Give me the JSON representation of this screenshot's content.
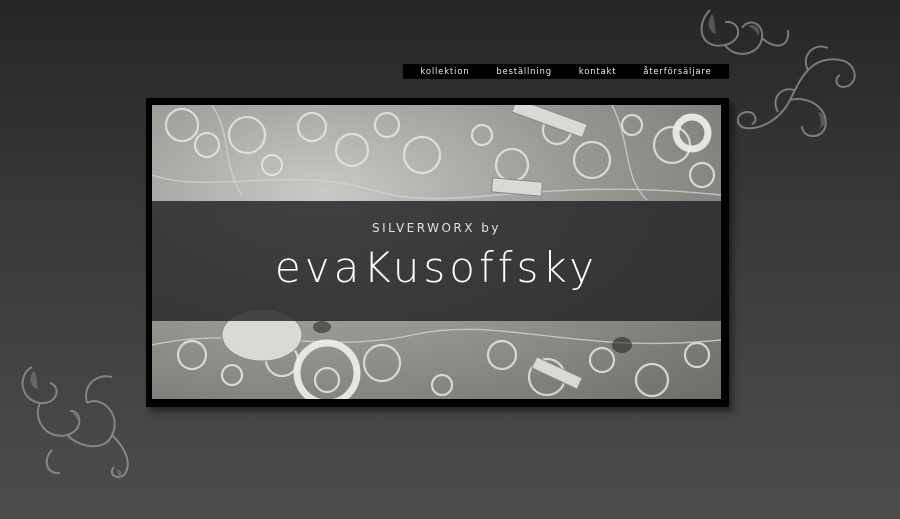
{
  "nav": {
    "items": [
      {
        "label": "kollektion"
      },
      {
        "label": "beställning"
      },
      {
        "label": "kontakt"
      },
      {
        "label": "återförsäljare"
      }
    ]
  },
  "banner": {
    "subtitle": "SILVERWORX by",
    "brand": "evaKusoffsky"
  },
  "colors": {
    "background_top": "#262626",
    "background_bottom": "#4d4d4d",
    "nav_background": "#000000",
    "band": "#232123"
  },
  "icons": {
    "top_flourish": "ornament-flourish-icon",
    "bottom_flourish": "ornament-flourish-icon"
  }
}
